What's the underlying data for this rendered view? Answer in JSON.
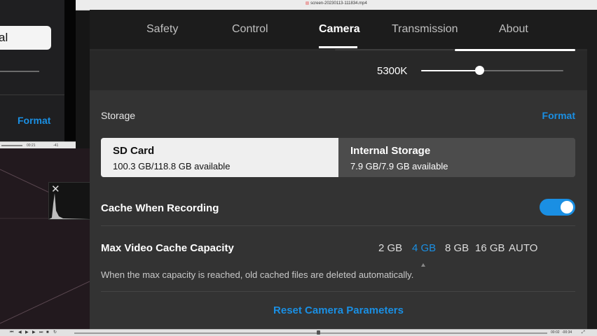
{
  "player_window": {
    "title": "screen-20230113-111834.mp4"
  },
  "background_window": {
    "pill_text": "al",
    "format_label": "Format",
    "scrub_time_a": "00:21",
    "scrub_time_b": "-41",
    "close_glyph": "✕"
  },
  "tabs": [
    {
      "label": "Safety"
    },
    {
      "label": "Control"
    },
    {
      "label": "Camera",
      "active": true
    },
    {
      "label": "Transmission"
    },
    {
      "label": "About"
    }
  ],
  "white_balance": {
    "value_label": "5300K",
    "level_fraction": 0.41
  },
  "storage": {
    "label": "Storage",
    "format_label": "Format",
    "options": [
      {
        "title": "SD Card",
        "subtitle": "100.3 GB/118.8 GB available",
        "selected": true
      },
      {
        "title": "Internal Storage",
        "subtitle": "7.9 GB/7.9 GB available",
        "selected": false
      }
    ]
  },
  "cache_when_recording": {
    "label": "Cache When Recording",
    "enabled": true
  },
  "max_video_cache": {
    "label": "Max Video Cache Capacity",
    "options": [
      "2 GB",
      "4 GB",
      "8 GB",
      "16 GB",
      "AUTO"
    ],
    "selected": "4 GB",
    "note": "When the max capacity is reached, old cached files are deleted automatically."
  },
  "reset_label": "Reset Camera Parameters",
  "colors": {
    "accent": "#1a8fe3",
    "panel": "#333333",
    "tab_bar": "#1c1c1c"
  },
  "player_bar": {
    "time_left": "00:02",
    "time_right": "-00:34"
  }
}
